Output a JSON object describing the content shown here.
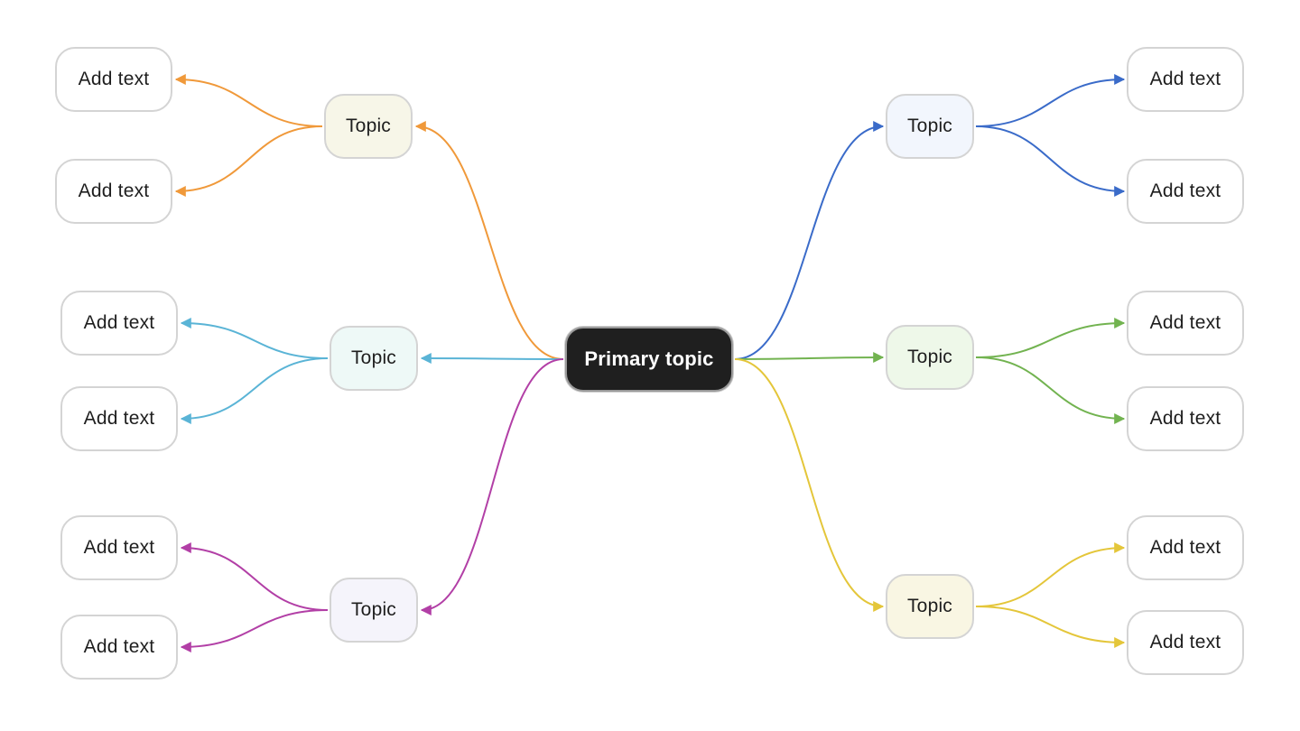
{
  "mindmap": {
    "root": {
      "label": "Primary topic",
      "fill": "#1f1f1f"
    },
    "branches": [
      {
        "id": "upper-left",
        "side": "left",
        "color": "#f0993a",
        "fill": "#f7f6e8",
        "label": "Topic",
        "children": [
          {
            "label": "Add text"
          },
          {
            "label": "Add text"
          }
        ]
      },
      {
        "id": "middle-left",
        "side": "left",
        "color": "#5ab4d6",
        "fill": "#eef9f7",
        "label": "Topic",
        "children": [
          {
            "label": "Add text"
          },
          {
            "label": "Add text"
          }
        ]
      },
      {
        "id": "lower-left",
        "side": "left",
        "color": "#b23fa6",
        "fill": "#f5f4fb",
        "label": "Topic",
        "children": [
          {
            "label": "Add text"
          },
          {
            "label": "Add text"
          }
        ]
      },
      {
        "id": "upper-right",
        "side": "right",
        "color": "#3a6bc9",
        "fill": "#f2f6fd",
        "label": "Topic",
        "children": [
          {
            "label": "Add text"
          },
          {
            "label": "Add text"
          }
        ]
      },
      {
        "id": "middle-right",
        "side": "right",
        "color": "#72b350",
        "fill": "#eef8e9",
        "label": "Topic",
        "children": [
          {
            "label": "Add text"
          },
          {
            "label": "Add text"
          }
        ]
      },
      {
        "id": "lower-right",
        "side": "right",
        "color": "#e4c63a",
        "fill": "#f9f6e3",
        "label": "Topic",
        "children": [
          {
            "label": "Add text"
          },
          {
            "label": "Add text"
          }
        ]
      }
    ]
  }
}
